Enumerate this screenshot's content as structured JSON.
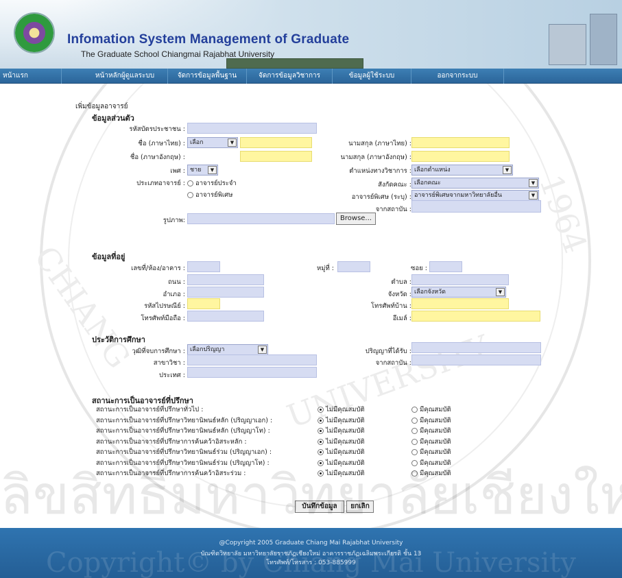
{
  "header": {
    "title": "Infomation System Management of Graduate",
    "subtitle": "The Graduate School Chiangmai Rajabhat University"
  },
  "nav": {
    "items": [
      {
        "label": "หน้าแรก"
      },
      {
        "label": "หน้าหลักผู้ดูแลระบบ"
      },
      {
        "label": "จัดการข้อมูลพื้นฐาน"
      },
      {
        "label": "จัดการข้อมูลวิชาการ"
      },
      {
        "label": "ข้อมูลผู้ใช้ระบบ"
      },
      {
        "label": "ออกจากระบบ"
      }
    ]
  },
  "page": {
    "heading": "เพิ่มข้อมูลอาจารย์"
  },
  "personal": {
    "title": "ข้อมูลส่วนตัว",
    "id_card_label": "รหัสบัตรประชาชน :",
    "name_th_label": "ชื่อ (ภาษาไทย) :",
    "prefix_select": "เลือก",
    "surname_th_label": "นามสกุล (ภาษาไทย) :",
    "name_en_label": "ชื่อ (ภาษาอังกฤษ) :",
    "surname_en_label": "นามสกุล (ภาษาอังกฤษ) :",
    "gender_label": "เพศ :",
    "gender_select": "ชาย",
    "academic_position_label": "ตำแหน่งทางวิชาการ :",
    "academic_position_select": "เลือกตำแหน่ง",
    "type_label": "ประเภทอาจารย์ :",
    "type_regular": "อาจารย์ประจำ",
    "type_special": "อาจารย์พิเศษ",
    "faculty_label": "สังกัดคณะ :",
    "faculty_select": "เลือกคณะ",
    "special_label": "อาจารย์พิเศษ (ระบุ) :",
    "special_select": "อาจารย์พิเศษจากมหาวิทยาลัยอื่น",
    "from_inst_label": "จากสถาบัน :",
    "photo_label": "รูปภาพ:",
    "browse_button": "Browse..."
  },
  "address": {
    "title": "ข้อมูลที่อยู่",
    "house_label": "เลขที่/ห้อง/อาคาร :",
    "moo_label": "หมู่ที่ :",
    "soi_label": "ซอย :",
    "road_label": "ถนน :",
    "tambon_label": "ตำบล :",
    "amphoe_label": "อำเภอ :",
    "province_label": "จังหวัด :",
    "province_select": "เลือกจังหวัด",
    "postcode_label": "รหัสไปรษณีย์ :",
    "home_phone_label": "โทรศัพท์บ้าน :",
    "mobile_label": "โทรศัพท์มือถือ :",
    "email_label": "อีเมล์ :"
  },
  "education": {
    "title": "ประวัติการศึกษา",
    "degree_level_label": "วุฒิที่จบการศึกษา :",
    "degree_level_select": "เลือกปริญญา",
    "degree_label": "ปริญญาที่ได้รับ :",
    "major_label": "สาขาวิชา :",
    "institution_label": "จากสถาบัน :",
    "country_label": "ประเทศ :"
  },
  "advisor": {
    "title": "สถานะการเป็นอาจารย์ที่ปรึกษา",
    "no_label": "ไม่มีคุณสมบัติ",
    "yes_label": "มีคุณสมบัติ",
    "rows": [
      {
        "label": "สถานะการเป็นอาจารย์ที่ปรึกษาทั่วไป :"
      },
      {
        "label": "สถานะการเป็นอาจารย์ที่ปรึกษาวิทยานิพนธ์หลัก (ปริญญาเอก) :"
      },
      {
        "label": "สถานะการเป็นอาจารย์ที่ปรึกษาวิทยานิพนธ์หลัก (ปริญญาโท) :"
      },
      {
        "label": "สถานะการเป็นอาจารย์ที่ปรึกษาการค้นคว้าอิสระหลัก :"
      },
      {
        "label": "สถานะการเป็นอาจารย์ที่ปรึกษาวิทยานิพนธ์ร่วม (ปริญญาเอก) :"
      },
      {
        "label": "สถานะการเป็นอาจารย์ที่ปรึกษาวิทยานิพนธ์ร่วม (ปริญญาโท) :"
      },
      {
        "label": "สถานะการเป็นอาจารย์ที่ปรึกษาการค้นคว้าอิสระร่วม :"
      }
    ]
  },
  "actions": {
    "save": "บันทึกข้อมูล",
    "cancel": "ยกเลิก"
  },
  "footer": {
    "line1": "@Copyright 2005 Graduate Chiang Mai Rajabhat University",
    "line2": "บัณฑิตวิทยาลัย มหาวิทยาลัยราชภัฏเชียงใหม่ อาคารราชภัฏเฉลิมพระเกียรติ ชั้น 13",
    "line3": "โทรศัพท์/โทรสาร : 053-885999"
  },
  "watermark": {
    "bottom_text": "ลิขสิทธิ์มหาวิทยาลัยเชียงใหม่",
    "copyright_text": "Copyright© by Chiang Mai University"
  }
}
